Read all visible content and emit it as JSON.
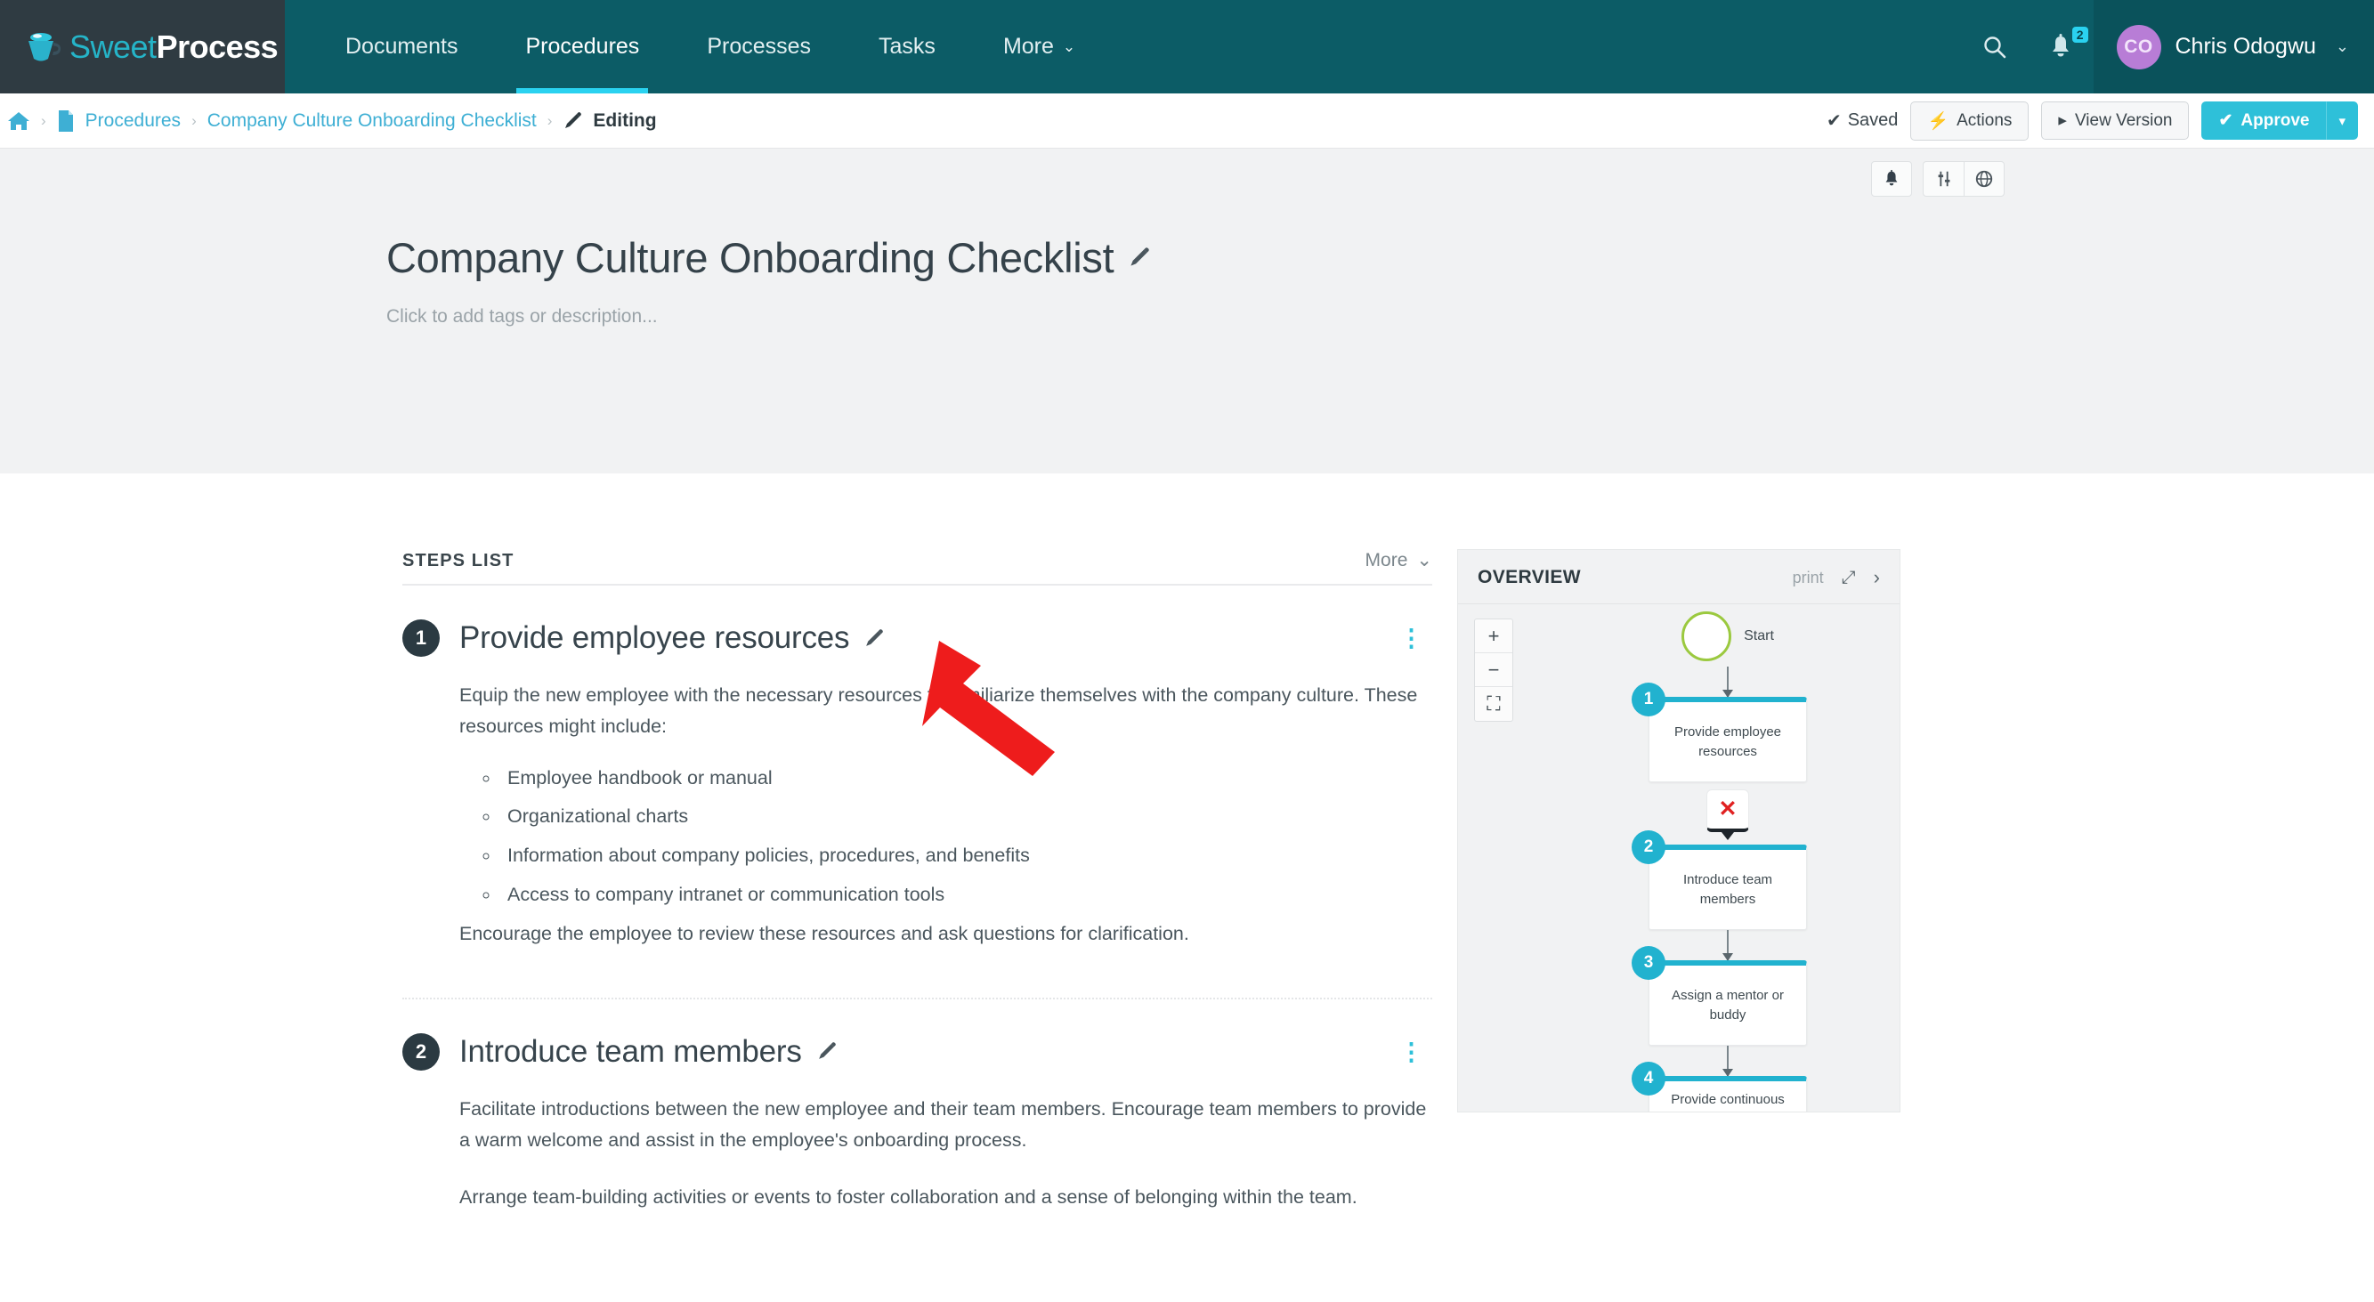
{
  "navbar": {
    "logo": {
      "sweet": "Sweet",
      "process": "Process",
      "icon": "coffee-cup-icon"
    },
    "items": [
      {
        "label": "Documents",
        "active": false,
        "caret": false
      },
      {
        "label": "Procedures",
        "active": true,
        "caret": false
      },
      {
        "label": "Processes",
        "active": false,
        "caret": false
      },
      {
        "label": "Tasks",
        "active": false,
        "caret": false
      },
      {
        "label": "More",
        "active": false,
        "caret": true
      }
    ],
    "more_caret": "⌄",
    "search_icon": "search-icon",
    "bell_icon": "bell-icon",
    "notification_count": "2",
    "user": {
      "initials": "CO",
      "name": "Chris Odogwu",
      "caret": "⌄"
    }
  },
  "breadcrumb": {
    "home_icon": "home-icon",
    "doc_icon": "document-icon",
    "pencil_icon": "pencil-icon",
    "separator": "›",
    "procedures": "Procedures",
    "document": "Company Culture Onboarding Checklist",
    "current": "Editing"
  },
  "crumb_actions": {
    "saved_label": "Saved",
    "saved_check": "✔",
    "actions_label": "Actions",
    "actions_icon": "⚡",
    "view_version_label": "View Version",
    "view_version_icon": "▸",
    "approve_label": "Approve",
    "approve_icon": "✔",
    "approve_caret": "▾"
  },
  "header": {
    "tool_buttons": [
      {
        "name": "bell-icon",
        "glyph": "🔔"
      },
      {
        "name": "sliders-icon",
        "glyph": "sliders"
      },
      {
        "name": "globe-icon",
        "glyph": "globe"
      }
    ],
    "title": "Company Culture Onboarding Checklist",
    "title_pencil": "pencil-icon",
    "subtitle": "Click to add tags or description..."
  },
  "steps_panel": {
    "heading": "STEPS LIST",
    "more_label": "More",
    "more_caret": "⌄",
    "kebab": "⋮",
    "steps": [
      {
        "number": "1",
        "title": "Provide employee resources",
        "intro": "Equip the new employee with the necessary resources to familiarize themselves with the company culture. These resources might include:",
        "bullets": [
          "Employee handbook or manual",
          "Organizational charts",
          "Information about company policies, procedures, and benefits",
          "Access to company intranet or communication tools"
        ],
        "tail": "Encourage the employee to review these resources and ask questions for clarification."
      },
      {
        "number": "2",
        "title": "Introduce team members",
        "paragraph_1": "Facilitate introductions between the new employee and their team members. Encourage team members to provide a warm welcome and assist in the employee's onboarding process.",
        "paragraph_2": "Arrange team-building activities or events to foster collaboration and a sense of belonging within the team."
      }
    ]
  },
  "overview": {
    "title": "OVERVIEW",
    "print_label": "print",
    "expand_icon": "⤢",
    "next_icon": "›",
    "zoom_in": "+",
    "zoom_out": "−",
    "zoom_fit": "⛶",
    "colors": {
      "node_accent": "#21b2cf",
      "start_ring": "#9bc93f",
      "gate_x": "#e02020"
    },
    "flow": {
      "start_label": "Start",
      "gate_symbol": "✕",
      "nodes": [
        {
          "number": "1",
          "label": "Provide employee resources"
        },
        {
          "number": "2",
          "label": "Introduce team members"
        },
        {
          "number": "3",
          "label": "Assign a mentor or buddy"
        },
        {
          "number": "4",
          "label": "Provide continuous training and development opportunities"
        }
      ]
    }
  },
  "annotation": {
    "arrow_color": "#ee1c1c"
  }
}
